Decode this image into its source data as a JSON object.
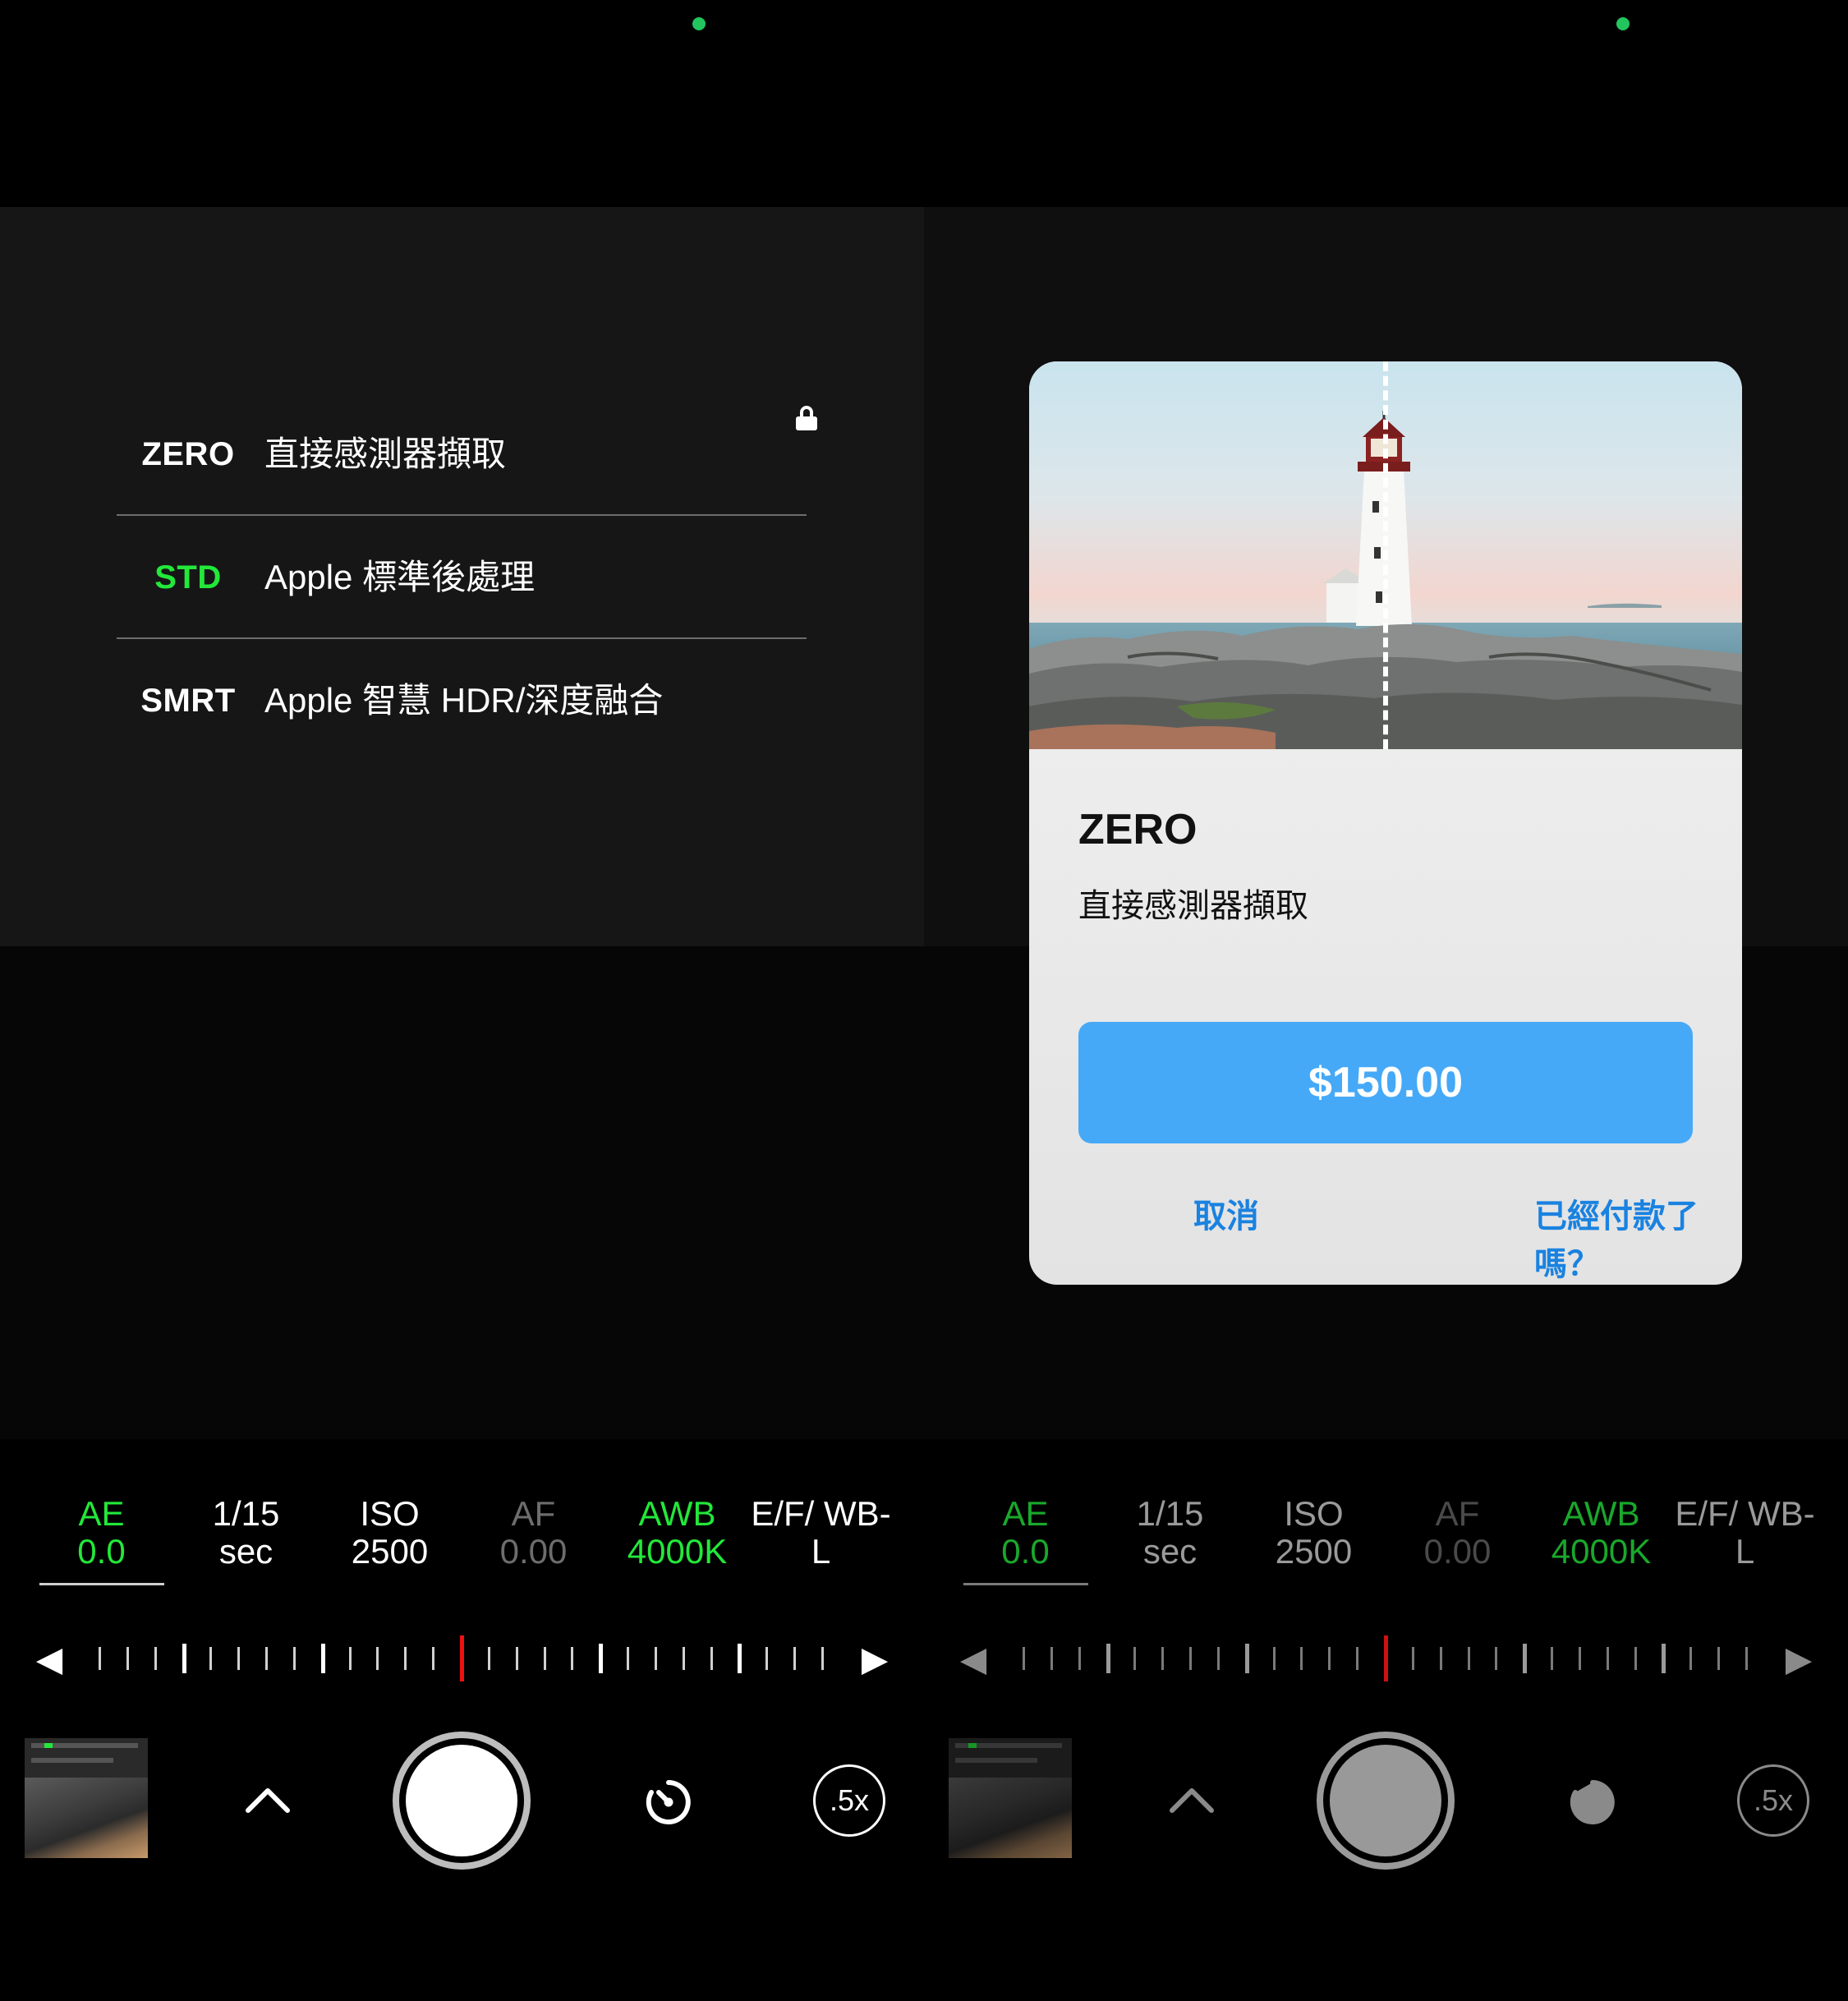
{
  "modes": [
    {
      "code": "ZERO",
      "desc": "直接感測器擷取",
      "active": false,
      "locked": true
    },
    {
      "code": "STD",
      "desc": "Apple 標準後處理",
      "active": true,
      "locked": false
    },
    {
      "code": "SMRT",
      "desc": "Apple 智慧 HDR/深度融合",
      "active": false,
      "locked": false
    }
  ],
  "params": [
    {
      "l1": "AE",
      "l2": "0.0",
      "color": "green"
    },
    {
      "l1": "1/15",
      "l2": "sec",
      "color": "white"
    },
    {
      "l1": "ISO",
      "l2": "2500",
      "color": "white"
    },
    {
      "l1": "AF",
      "l2": "0.00",
      "color": "gray"
    },
    {
      "l1": "AWB",
      "l2": "4000K",
      "color": "green"
    },
    {
      "l1": "E/F/ WB-",
      "l2": "L",
      "color": "white"
    }
  ],
  "controls": {
    "left_arrow": "◀",
    "right_arrow": "▶",
    "zoom_label": ".5x"
  },
  "dialog": {
    "title": "ZERO",
    "subtitle": "直接感測器擷取",
    "price": "$150.00",
    "cancel": "取消",
    "restore": "已經付款了嗎？"
  },
  "colors": {
    "accent_green": "#22e83a",
    "button_blue": "#46a9f7",
    "link_blue": "#1a82e0",
    "ruler_center": "#ee1111"
  },
  "icons": [
    "lock-icon",
    "chevron-up-icon",
    "timer-icon",
    "shutter-button",
    "zoom-toggle"
  ]
}
